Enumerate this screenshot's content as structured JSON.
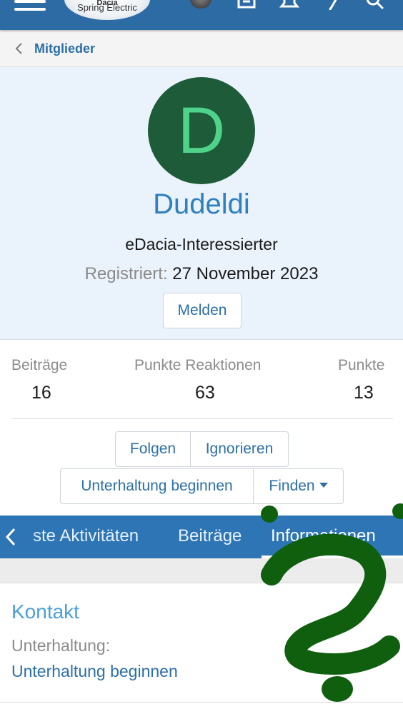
{
  "header": {
    "logo_line1": "Dacia",
    "logo_line2": "Spring Electric"
  },
  "breadcrumb": {
    "label": "Mitglieder"
  },
  "profile": {
    "avatar_letter": "D",
    "username": "Dudeldi",
    "user_title": "eDacia-Interessierter",
    "registered_label": "Registriert:",
    "registered_value": "27 November 2023",
    "report_label": "Melden"
  },
  "stats": [
    {
      "label": "Beiträge",
      "value": "16"
    },
    {
      "label": "Punkte Reaktionen",
      "value": "63"
    },
    {
      "label": "Punkte",
      "value": "13"
    }
  ],
  "actions": {
    "follow": "Folgen",
    "ignore": "Ignorieren",
    "start_conversation": "Unterhaltung beginnen",
    "find": "Finden"
  },
  "tabs": {
    "items": [
      {
        "label": "ste Aktivitäten"
      },
      {
        "label": "Beiträge"
      },
      {
        "label": "Informationen"
      }
    ],
    "active_index": 2
  },
  "contact": {
    "heading": "Kontakt",
    "conversation_label": "Unterhaltung:",
    "conversation_link": "Unterhaltung beginnen"
  },
  "colors": {
    "brand_blue": "#2d75b4",
    "avatar_bg": "#1e5b39",
    "avatar_letter": "#4fd28a",
    "scribble_green": "#0f5f0f"
  },
  "icons": {
    "menu": "hamburger-icon",
    "back": "chevron-left-icon",
    "inbox": "inbox-icon",
    "bell": "bell-icon",
    "pen": "pen-icon",
    "search": "search-icon",
    "dropdown": "caret-down-icon",
    "overlay": "question-mark-scribble"
  }
}
